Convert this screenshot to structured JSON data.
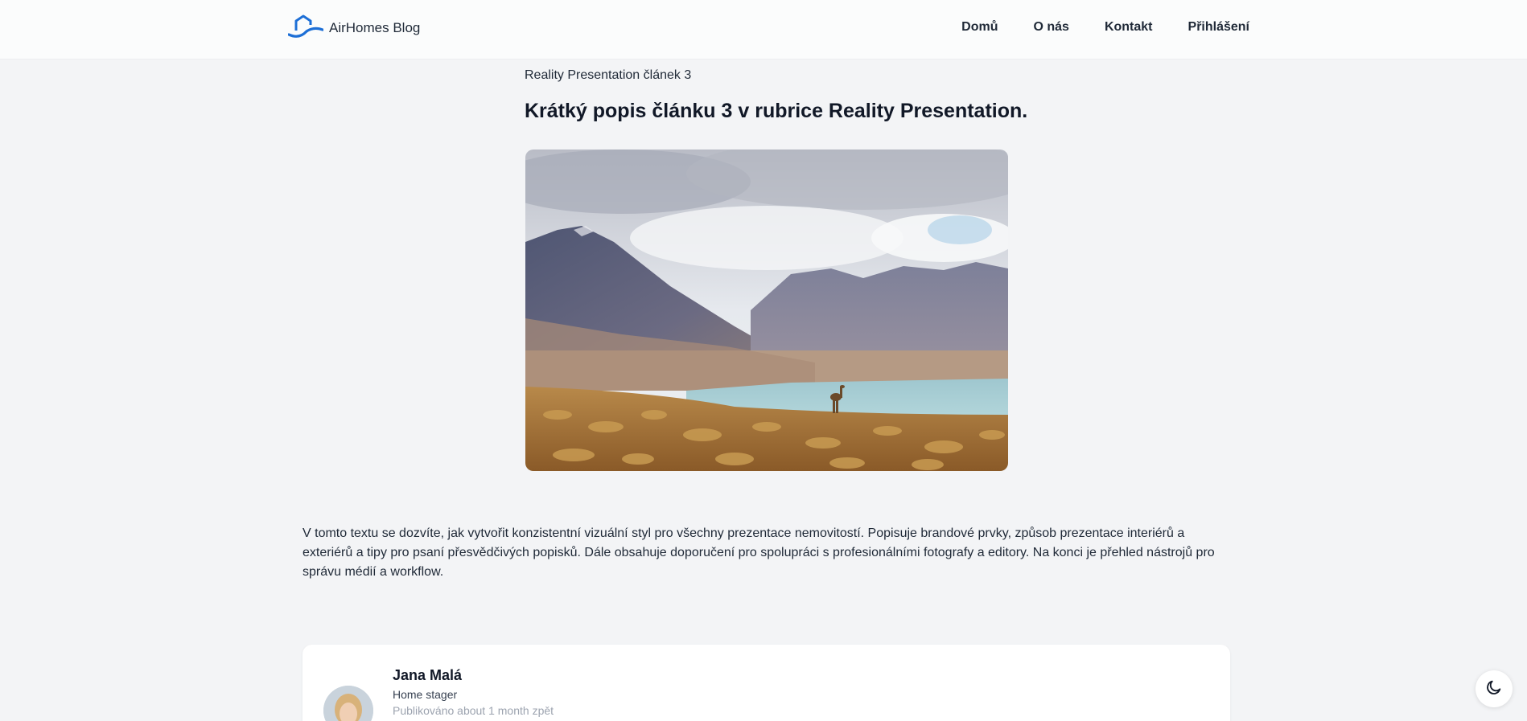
{
  "header": {
    "brand_name": "AirHomes Blog",
    "logo_icon": "house-roof-icon",
    "nav": [
      {
        "label": "Domů"
      },
      {
        "label": "O nás"
      },
      {
        "label": "Kontakt"
      },
      {
        "label": "Přihlášení"
      }
    ]
  },
  "article": {
    "category_title": "Reality Presentation článek 3",
    "headline": "Krátký popis článku 3 v rubrice Reality Presentation.",
    "image_alt": "mountain-lake-landscape-image",
    "body": "V tomto textu se dozvíte, jak vytvořit konzistentní vizuální styl pro všechny prezentace nemovitostí. Popisuje brandové prvky, způsob prezentace interiérů a exteriérů a tipy pro psaní přesvědčivých popisků. Dále obsahuje doporučení pro spolupráci s profesionálními fotografy a editory. Na konci je přehled nástrojů pro správu médií a workflow."
  },
  "author": {
    "name": "Jana Malá",
    "role": "Home stager",
    "published": "Publikováno about 1 month zpět"
  },
  "theme_toggle_icon": "moon-icon",
  "colors": {
    "brand_blue": "#1d6fd6",
    "background": "#f3f4f6",
    "header_bg": "#fbfcfc"
  }
}
